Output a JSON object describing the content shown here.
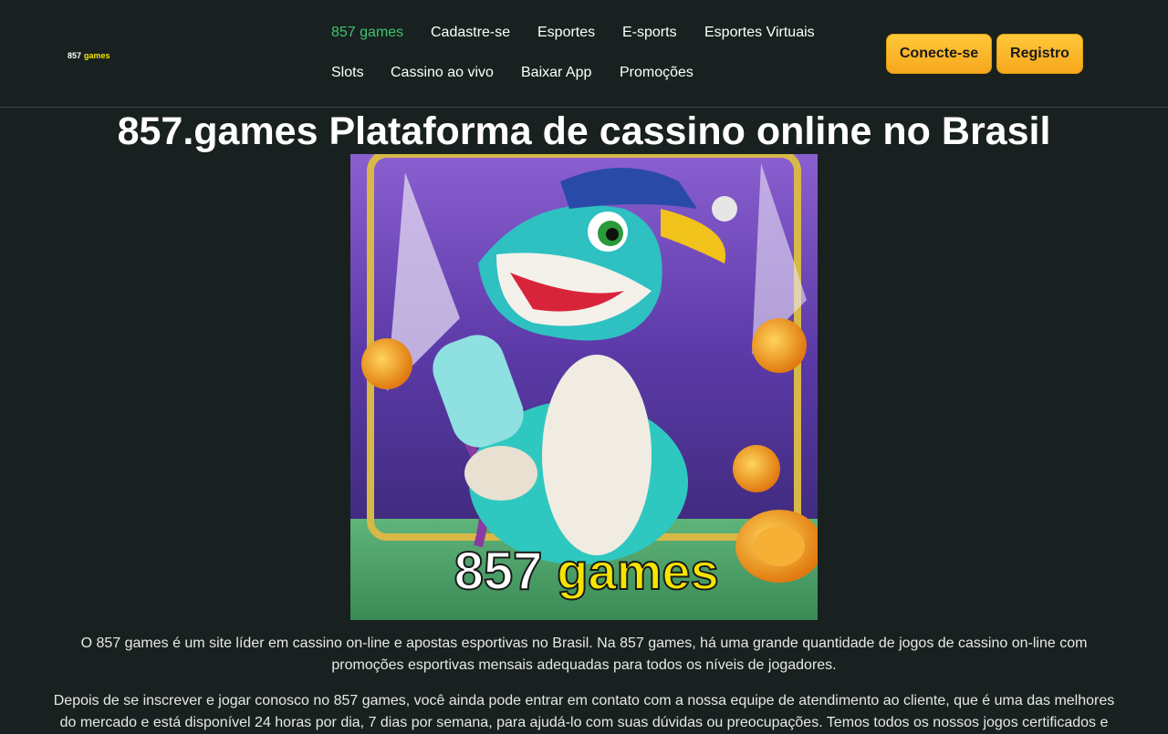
{
  "logo": {
    "num": "857",
    "word": "games"
  },
  "nav": {
    "items": [
      "857 games",
      "Cadastre-se",
      "Esportes",
      "E-sports",
      "Esportes Virtuais",
      "Slots",
      "Cassino ao vivo",
      "Baixar App",
      "Promoções"
    ]
  },
  "actions": {
    "login": "Conecte-se",
    "register": "Registro"
  },
  "page": {
    "title": "857.games Plataforma de cassino online no Brasil"
  },
  "hero": {
    "num": "857",
    "word": "games"
  },
  "content": {
    "p1_l1": "O 857 games é um site líder em cassino on-line e apostas esportivas no Brasil. Na 857 games, há uma grande quantidade de jogos de cassino on-line com",
    "p1_l2": "promoções esportivas mensais adequadas para todos os níveis de jogadores.",
    "p2_l1": "Depois de se inscrever e jogar conosco no 857 games, você ainda pode entrar em contato com a nossa equipe de atendimento ao cliente, que é uma das melhores",
    "p2_l2": "do mercado e está disponível 24 horas por dia, 7 dias por semana, para ajudá-lo com suas dúvidas ou preocupações. Temos todos os nossos jogos certificados e"
  },
  "colors": {
    "accent": "#f7a71c",
    "active": "#3fc36f",
    "bg": "#182120"
  }
}
